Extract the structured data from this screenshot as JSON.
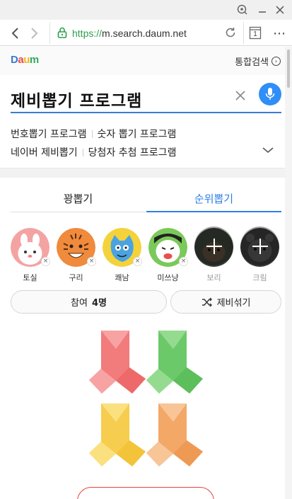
{
  "browser": {
    "url_scheme": "https://",
    "url_host": "m.search.daum.net",
    "tab_count": "1",
    "menu_icon": "more-dots-icon"
  },
  "daum": {
    "logo_text": "Daum",
    "integrated_search_label": "통합검색"
  },
  "search": {
    "query": "제비뽑기 프로그램"
  },
  "related_searches": [
    [
      "번호뽑기 프로그램",
      "숫자 뽑기 프로그램"
    ],
    [
      "네이버 제비뽑기",
      "당첨자 추첨 프로그램"
    ]
  ],
  "draw_tabs": {
    "inactive": "꽝뽑기",
    "active": "순위뽑기"
  },
  "characters": [
    {
      "name": "토실",
      "color": "#f4a3a3",
      "removable": true
    },
    {
      "name": "구리",
      "color": "#f08a3c",
      "removable": true
    },
    {
      "name": "쾌남",
      "color": "#f3d23b",
      "removable": true
    },
    {
      "name": "미쓰냥",
      "color": "#7bc95a",
      "removable": true
    },
    {
      "name": "보리",
      "color": "#3a3f38",
      "removable": false
    },
    {
      "name": "크림",
      "color": "#3a3a3a",
      "removable": false
    }
  ],
  "actions": {
    "join_label": "참여",
    "join_count": "4명",
    "shuffle_label": "제비섞기"
  },
  "lots": [
    {
      "color": "#f27b7b",
      "light": "#f7a3a3"
    },
    {
      "color": "#6cc96a",
      "light": "#95db8f"
    },
    {
      "color": "#f7cd4f",
      "light": "#fbe07f"
    },
    {
      "color": "#f3a868",
      "light": "#f8c597"
    }
  ],
  "colors": {
    "accent_blue": "#2f7fe6",
    "mic_blue": "#2f8ef7",
    "secure_green": "#2b9f4a",
    "start_red": "#e8453c"
  }
}
